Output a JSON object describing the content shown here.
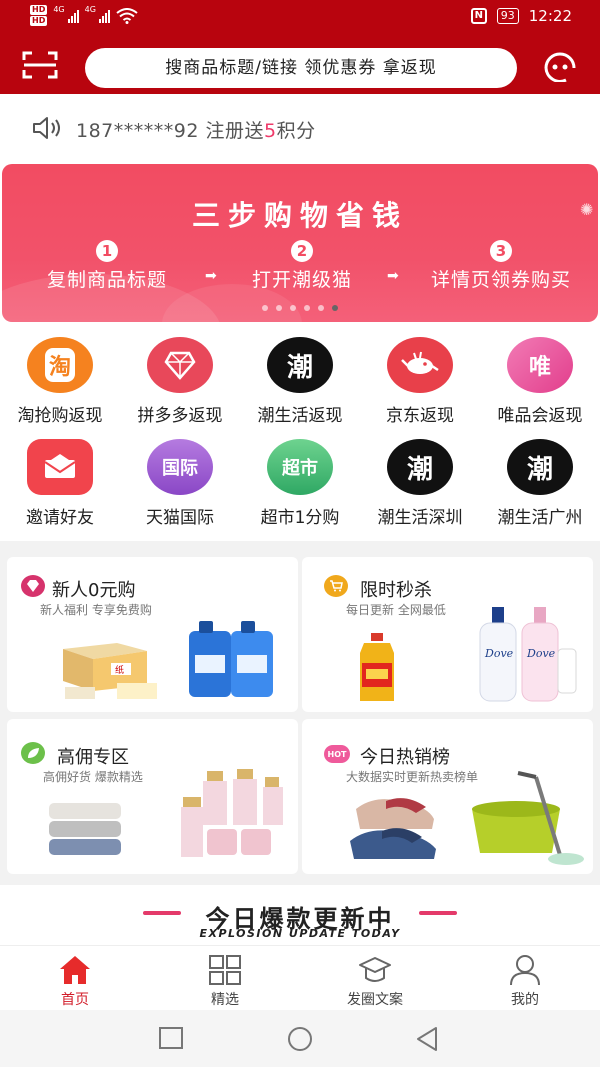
{
  "status_bar": {
    "hd1": "HD",
    "hd2": "HD",
    "net1": "4G",
    "net2": "4G",
    "battery": "93",
    "time": "12:22"
  },
  "header": {
    "search_placeholder": "搜商品标题/链接 领优惠券 拿返现",
    "brand_color": "#b8040e"
  },
  "notice": {
    "phone": "187******92 注册送",
    "points": "5",
    "unit": "积分"
  },
  "banner": {
    "title": "三步购物省钱",
    "steps": [
      {
        "num": "1",
        "text": "复制商品标题"
      },
      {
        "num": "2",
        "text": "打开潮级猫"
      },
      {
        "num": "3",
        "text": "详情页领券购买"
      }
    ],
    "dots": 6,
    "active_dot": 6
  },
  "categories": [
    {
      "label": "淘抢购返现",
      "icon": "taobao-icon",
      "glyph": "淘",
      "color": "#f5821f"
    },
    {
      "label": "拼多多返现",
      "icon": "pinduoduo-icon",
      "glyph": "",
      "color": "#e8485a"
    },
    {
      "label": "潮生活返现",
      "icon": "chaoshenghuo-icon",
      "glyph": "潮",
      "color": "#111111"
    },
    {
      "label": "京东返现",
      "icon": "jd-icon",
      "glyph": "",
      "color": "#e8404a"
    },
    {
      "label": "唯品会返现",
      "icon": "vip-icon",
      "glyph": "唯",
      "color": "#ee5a9b"
    },
    {
      "label": "邀请好友",
      "icon": "invite-icon",
      "glyph": "",
      "color": "#f1444c"
    },
    {
      "label": "天猫国际",
      "icon": "tmall-global-icon",
      "glyph": "国际",
      "color": "#9b59d0"
    },
    {
      "label": "超市1分购",
      "icon": "supermarket-icon",
      "glyph": "超市",
      "color": "#3cb371"
    },
    {
      "label": "潮生活深圳",
      "icon": "chaoshenghuo-sz-icon",
      "glyph": "潮",
      "color": "#111111"
    },
    {
      "label": "潮生活广州",
      "icon": "chaoshenghuo-gz-icon",
      "glyph": "潮",
      "color": "#111111"
    }
  ],
  "promos": [
    {
      "title": "新人0元购",
      "subtitle": "新人福利 专享免费购",
      "icon": "diamond-icon",
      "badge_color": "#d6336c"
    },
    {
      "title": "限时秒杀",
      "subtitle": "每日更新 全网最低",
      "icon": "cart-icon",
      "badge_color": "#f0a81c"
    },
    {
      "title": "高佣专区",
      "subtitle": "高佣好货 爆款精选",
      "icon": "leaf-icon",
      "badge_color": "#6cc04a"
    },
    {
      "title": "今日热销榜",
      "subtitle": "大数据实时更新热卖榜单",
      "icon": "hot-icon",
      "badge_color": "#ef5a9b",
      "badge_text": "HOT"
    }
  ],
  "hot_section": {
    "title": "今日爆款更新中",
    "subtitle": "EXPLOSION UPDATE TODAY"
  },
  "tabbar": [
    {
      "label": "首页",
      "icon": "home-icon",
      "active": true
    },
    {
      "label": "精选",
      "icon": "grid-icon",
      "active": false
    },
    {
      "label": "发圈文案",
      "icon": "graduation-cap-icon",
      "active": false
    },
    {
      "label": "我的",
      "icon": "user-icon",
      "active": false
    }
  ]
}
